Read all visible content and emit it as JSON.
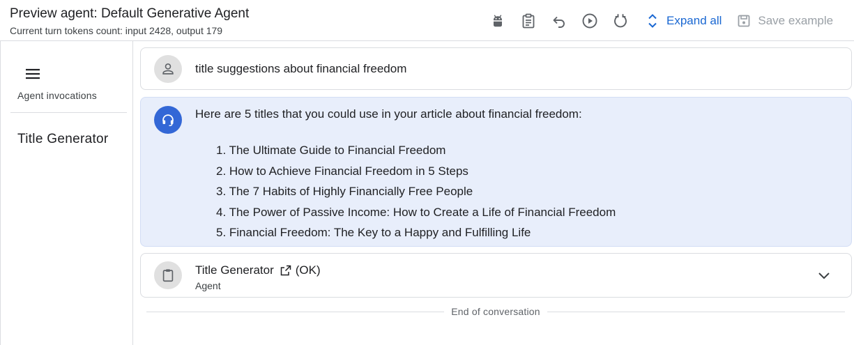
{
  "header": {
    "title": "Preview agent: Default Generative Agent",
    "subtitle": "Current turn tokens count: input 2428, output 179"
  },
  "toolbar": {
    "icons": [
      "android-icon",
      "clipboard-icon",
      "undo-icon",
      "play-icon",
      "reset-icon"
    ],
    "expand_label": "Expand all",
    "save_label": "Save example",
    "accent_color": "#1967d2",
    "disabled_color": "#9aa0a6"
  },
  "sidebar": {
    "section_label": "Agent invocations",
    "items": [
      {
        "label": "Title Generator"
      }
    ]
  },
  "conversation": {
    "user_message": "title suggestions about financial freedom",
    "agent_intro": "Here are 5 titles that you could use in your article about financial freedom:",
    "agent_list": [
      "1. The Ultimate Guide to Financial Freedom",
      "2. How to Achieve Financial Freedom in 5 Steps",
      "3. The 7 Habits of Highly Financially Free People",
      "4. The Power of Passive Income: How to Create a Life of Financial Freedom",
      "5. Financial Freedom: The Key to a Happy and Fulfilling Life"
    ],
    "agent_bubble_color": "#e8eefb",
    "agent_avatar_color": "#3367d6",
    "tool_call": {
      "name": "Title Generator",
      "status": "(OK)",
      "type": "Agent"
    },
    "end_text": "End of conversation"
  }
}
